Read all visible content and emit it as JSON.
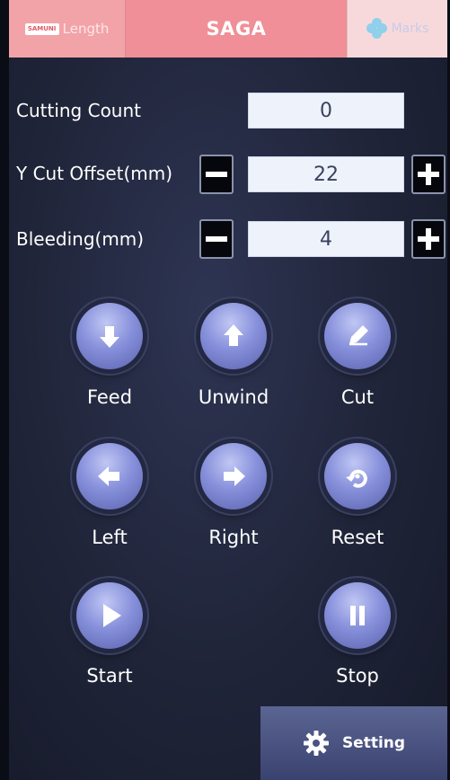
{
  "tabs": {
    "length_logo": "SAMUNI",
    "length_label": "Length",
    "title": "SAGA",
    "marks_label": "Marks"
  },
  "fields": {
    "cutting_count": {
      "label": "Cutting Count",
      "value": "0"
    },
    "y_cut_offset": {
      "label": "Y Cut Offset(mm)",
      "value": "22"
    },
    "bleeding": {
      "label": "Bleeding(mm)",
      "value": "4"
    }
  },
  "buttons": {
    "feed": {
      "label": "Feed",
      "icon": "arrow-down-icon"
    },
    "unwind": {
      "label": "Unwind",
      "icon": "arrow-up-icon"
    },
    "cut": {
      "label": "Cut",
      "icon": "blade-icon"
    },
    "left": {
      "label": "Left",
      "icon": "arrow-left-icon"
    },
    "right": {
      "label": "Right",
      "icon": "arrow-right-icon"
    },
    "reset": {
      "label": "Reset",
      "icon": "reset-icon"
    },
    "start": {
      "label": "Start",
      "icon": "play-icon"
    },
    "stop": {
      "label": "Stop",
      "icon": "pause-icon"
    }
  },
  "setting": {
    "label": "Setting",
    "icon": "gear-icon"
  },
  "colors": {
    "tab_active": "#f08f97",
    "tab_inactive": "#f2a3a8",
    "button": "#8790db",
    "background": "#1f2438"
  }
}
